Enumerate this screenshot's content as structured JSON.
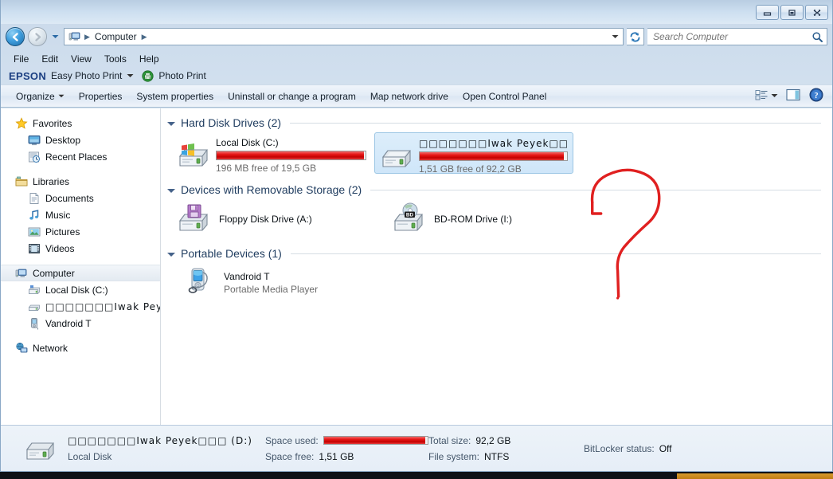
{
  "window": {
    "minimize_label": "Minimize",
    "maximize_label": "Maximize",
    "close_label": "Close"
  },
  "address": {
    "back_label": "Back",
    "forward_label": "Forward",
    "history_label": "Recent pages",
    "crumbs": [
      "Computer"
    ],
    "dropdown_label": "Previous locations",
    "refresh_label": "Refresh"
  },
  "search": {
    "placeholder": "Search Computer",
    "value": "",
    "button_label": "Search"
  },
  "menubar": {
    "items": [
      "File",
      "Edit",
      "View",
      "Tools",
      "Help"
    ]
  },
  "epson_bar": {
    "logo": "EPSON",
    "easy_photo_print": "Easy Photo Print",
    "photo_print": "Photo Print"
  },
  "commandbar": {
    "organize": "Organize",
    "properties": "Properties",
    "system_properties": "System properties",
    "uninstall": "Uninstall or change a program",
    "map_network_drive": "Map network drive",
    "open_control_panel": "Open Control Panel",
    "change_view_label": "Change your view",
    "preview_pane_label": "Show the preview pane",
    "help_label": "Get help"
  },
  "navpane": {
    "groups": [
      {
        "header": "Favorites",
        "items": [
          {
            "label": "Desktop",
            "icon": "desktop-icon"
          },
          {
            "label": "Recent Places",
            "icon": "recent-places-icon"
          }
        ]
      },
      {
        "header": "Libraries",
        "items": [
          {
            "label": "Documents",
            "icon": "documents-icon"
          },
          {
            "label": "Music",
            "icon": "music-icon"
          },
          {
            "label": "Pictures",
            "icon": "pictures-icon"
          },
          {
            "label": "Videos",
            "icon": "videos-icon"
          }
        ]
      },
      {
        "header": "Computer",
        "selected": true,
        "items": [
          {
            "label": "Local Disk (C:)",
            "icon": "hard-drive-icon"
          },
          {
            "label": "□□□□□□□Iwak Peyek□□□  (D",
            "icon": "removable-drive-icon"
          },
          {
            "label": "Vandroid T",
            "icon": "portable-device-icon"
          }
        ]
      },
      {
        "header": "Network",
        "items": []
      }
    ]
  },
  "content": {
    "sections": [
      {
        "title": "Hard Disk Drives (2)",
        "kind": "drives",
        "items": [
          {
            "name": "Local Disk (C:)",
            "free_text": "196 MB free of 19,5 GB",
            "used_percent": 99,
            "selected": false,
            "icon": "system-drive-icon"
          },
          {
            "name": "□□□□□□□Iwak Peyek□□□  (D:)",
            "free_text": "1,51 GB free of 92,2 GB",
            "used_percent": 98,
            "selected": true,
            "icon": "hard-drive-icon"
          }
        ]
      },
      {
        "title": "Devices with Removable Storage (2)",
        "kind": "items",
        "items": [
          {
            "name": "Floppy Disk Drive (A:)",
            "sub": "",
            "icon": "floppy-drive-icon"
          },
          {
            "name": "BD-ROM Drive (I:)",
            "sub": "",
            "icon": "bdrom-drive-icon"
          }
        ]
      },
      {
        "title": "Portable Devices (1)",
        "kind": "items",
        "items": [
          {
            "name": "Vandroid T",
            "sub": "Portable Media Player",
            "icon": "media-player-icon"
          }
        ]
      }
    ]
  },
  "annotation": {
    "shape": "question-mark",
    "color": "#e02020"
  },
  "details": {
    "name": "□□□□□□□Iwak Peyek□□□  (D:)",
    "type": "Local Disk",
    "space_used_label": "Space used:",
    "space_free_label": "Space free:",
    "space_free_value": "1,51 GB",
    "total_size_label": "Total size:",
    "total_size_value": "92,2 GB",
    "file_system_label": "File system:",
    "file_system_value": "NTFS",
    "bitlocker_label": "BitLocker status:",
    "bitlocker_value": "Off",
    "used_percent": 98
  },
  "colors": {
    "accent": "#1b3f82",
    "drive_full": "#e81818",
    "annotation": "#e02020",
    "section_header": "#1f3c5f",
    "taskbar_button": "#c07d14"
  }
}
